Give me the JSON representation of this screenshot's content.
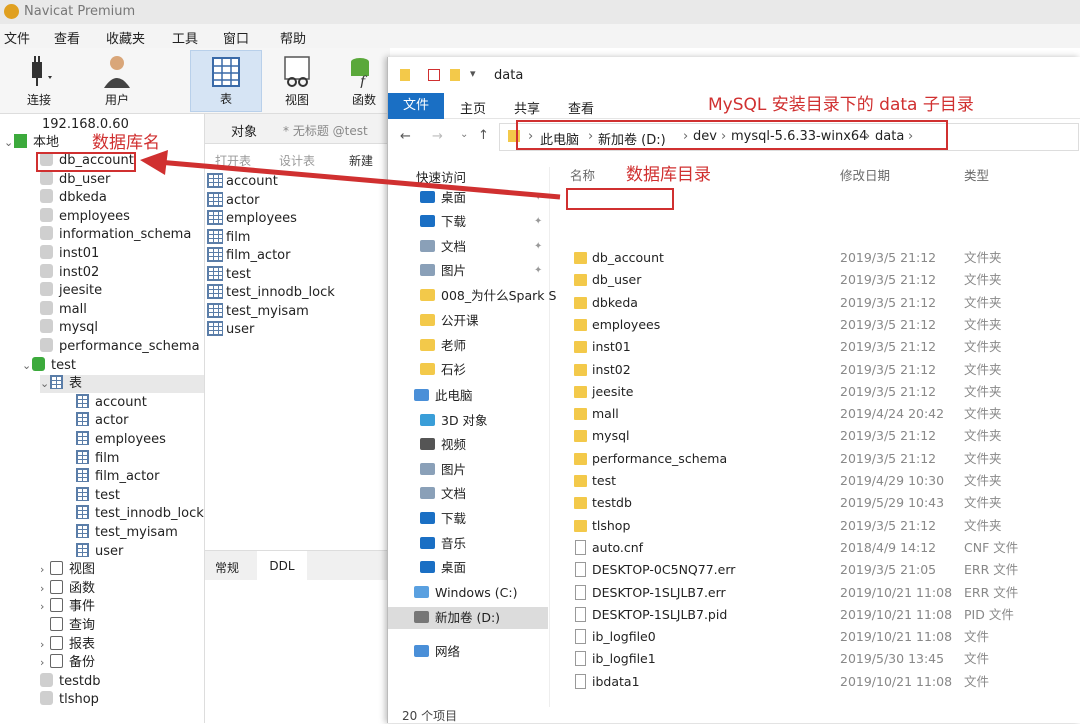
{
  "app": {
    "title": "Navicat Premium"
  },
  "menu": [
    "文件",
    "查看",
    "收藏夹",
    "工具",
    "窗口",
    "帮助"
  ],
  "ribbon": {
    "connect": "连接",
    "user": "用户",
    "table": "表",
    "view": "视图",
    "function": "函数"
  },
  "tree": {
    "connection": "192.168.0.60",
    "local": "本地",
    "databases": [
      "db_account",
      "db_user",
      "dbkeda",
      "employees",
      "information_schema",
      "inst01",
      "inst02",
      "jeesite",
      "mall",
      "mysql",
      "performance_schema"
    ],
    "test_db": "test",
    "tables_node": "表",
    "tables": [
      "account",
      "actor",
      "employees",
      "film",
      "film_actor",
      "test",
      "test_innodb_lock",
      "test_myisam",
      "user"
    ],
    "objects": [
      "视图",
      "函数",
      "事件",
      "查询",
      "报表",
      "备份"
    ],
    "after": [
      "testdb",
      "tlshop"
    ]
  },
  "middle": {
    "tab_objects": "对象",
    "tab_untitled": "* 无标题 @test",
    "toolbar": [
      "打开表",
      "设计表",
      "新建"
    ],
    "tables": [
      "account",
      "actor",
      "employees",
      "film",
      "film_actor",
      "test",
      "test_innodb_lock",
      "test_myisam",
      "user"
    ],
    "bottom_tabs": [
      "常规",
      "DDL"
    ]
  },
  "explorer": {
    "title": "data",
    "ribbon_tabs": [
      "文件",
      "主页",
      "共享",
      "查看"
    ],
    "breadcrumb": [
      "此电脑",
      "新加卷 (D:)",
      "dev",
      "mysql-5.6.33-winx64",
      "data"
    ],
    "nav": {
      "quick_access": "快速访问",
      "items": [
        "桌面",
        "下载",
        "文档",
        "图片",
        "008_为什么Spark S",
        "公开课",
        "老师",
        "石衫",
        "此电脑",
        "3D 对象",
        "视频",
        "图片",
        "文档",
        "下载",
        "音乐",
        "桌面",
        "Windows (C:)",
        "新加卷 (D:)",
        "网络"
      ]
    },
    "headers": [
      "名称",
      "修改日期",
      "类型"
    ],
    "files": [
      {
        "name": "db_account",
        "date": "2019/3/5 21:12",
        "type": "文件夹",
        "kind": "folder"
      },
      {
        "name": "db_user",
        "date": "2019/3/5 21:12",
        "type": "文件夹",
        "kind": "folder"
      },
      {
        "name": "dbkeda",
        "date": "2019/3/5 21:12",
        "type": "文件夹",
        "kind": "folder"
      },
      {
        "name": "employees",
        "date": "2019/3/5 21:12",
        "type": "文件夹",
        "kind": "folder"
      },
      {
        "name": "inst01",
        "date": "2019/3/5 21:12",
        "type": "文件夹",
        "kind": "folder"
      },
      {
        "name": "inst02",
        "date": "2019/3/5 21:12",
        "type": "文件夹",
        "kind": "folder"
      },
      {
        "name": "jeesite",
        "date": "2019/3/5 21:12",
        "type": "文件夹",
        "kind": "folder"
      },
      {
        "name": "mall",
        "date": "2019/4/24 20:42",
        "type": "文件夹",
        "kind": "folder"
      },
      {
        "name": "mysql",
        "date": "2019/3/5 21:12",
        "type": "文件夹",
        "kind": "folder"
      },
      {
        "name": "performance_schema",
        "date": "2019/3/5 21:12",
        "type": "文件夹",
        "kind": "folder"
      },
      {
        "name": "test",
        "date": "2019/4/29 10:30",
        "type": "文件夹",
        "kind": "folder"
      },
      {
        "name": "testdb",
        "date": "2019/5/29 10:43",
        "type": "文件夹",
        "kind": "folder"
      },
      {
        "name": "tlshop",
        "date": "2019/3/5 21:12",
        "type": "文件夹",
        "kind": "folder"
      },
      {
        "name": "auto.cnf",
        "date": "2018/4/9 14:12",
        "type": "CNF 文件",
        "kind": "file"
      },
      {
        "name": "DESKTOP-0C5NQ77.err",
        "date": "2019/3/5 21:05",
        "type": "ERR 文件",
        "kind": "file"
      },
      {
        "name": "DESKTOP-1SLJLB7.err",
        "date": "2019/10/21 11:08",
        "type": "ERR 文件",
        "kind": "file"
      },
      {
        "name": "DESKTOP-1SLJLB7.pid",
        "date": "2019/10/21 11:08",
        "type": "PID 文件",
        "kind": "file"
      },
      {
        "name": "ib_logfile0",
        "date": "2019/10/21 11:08",
        "type": "文件",
        "kind": "file"
      },
      {
        "name": "ib_logfile1",
        "date": "2019/5/30 13:45",
        "type": "文件",
        "kind": "file"
      },
      {
        "name": "ibdata1",
        "date": "2019/10/21 11:08",
        "type": "文件",
        "kind": "file"
      }
    ],
    "status": "20 个项目"
  },
  "annotations": {
    "db_name": "数据库名",
    "db_dir": "数据库目录",
    "data_dir": "MySQL 安装目录下的 data 子目录"
  },
  "colors": {
    "annotation": "#d03030",
    "accent": "#1a6fc4",
    "folder": "#f3c94a"
  }
}
